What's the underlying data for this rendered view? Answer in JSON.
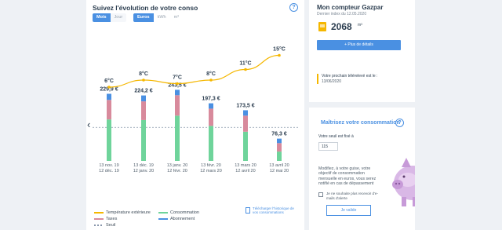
{
  "consumption": {
    "title": "Suivez l'évolution de votre conso",
    "period_options": [
      {
        "label": "Mois",
        "active": true
      },
      {
        "label": "Jour",
        "active": false
      }
    ],
    "unit_options": [
      {
        "label": "Euros",
        "active": true
      },
      {
        "label": "kWh",
        "active": false
      },
      {
        "label": "m³",
        "active": false
      }
    ],
    "legend": {
      "temperature": "Température extérieure",
      "taxes": "Taxes",
      "threshold": "Seuil",
      "consumption": "Consommation",
      "subscription": "Abonnement"
    },
    "download_link": "Télécharger l'historique de vos consommations"
  },
  "chart_data": {
    "type": "bar",
    "categories": [
      [
        "13 nov. 19",
        "12 déc. 19"
      ],
      [
        "13 déc. 19",
        "12 janv. 20"
      ],
      [
        "13 janv. 20",
        "12 févr. 20"
      ],
      [
        "13 févr. 20",
        "12 mars 20"
      ],
      [
        "13 mars 20",
        "12 avril 20"
      ],
      [
        "13 avril 20",
        "12 mai 20"
      ]
    ],
    "totals": [
      "229,9 €",
      "224,2 €",
      "243,5 €",
      "197,3 €",
      "173,5 €",
      "76,3 €"
    ],
    "total_values": [
      229.9,
      224.2,
      243.5,
      197.3,
      173.5,
      76.3
    ],
    "series": [
      {
        "name": "Consommation",
        "color": "#6fd49b",
        "values": [
          142,
          140,
          155,
          120,
          100,
          32
        ]
      },
      {
        "name": "Taxes",
        "color": "#d88a9c",
        "values": [
          67,
          64,
          70,
          59,
          55,
          29
        ]
      },
      {
        "name": "Abonnement",
        "color": "#4a90e2",
        "values": [
          20.9,
          20.2,
          18.5,
          18.3,
          18.5,
          15.3
        ]
      }
    ],
    "threshold": {
      "name": "Seuil",
      "value": 115,
      "color": "#8896ab"
    },
    "temperature": {
      "name": "Température extérieure",
      "color": "#f5b700",
      "values": [
        6,
        8,
        7,
        8,
        11,
        15
      ],
      "labels": [
        "6°C",
        "8°C",
        "7°C",
        "8°C",
        "11°C",
        "15°C"
      ]
    },
    "ylim": [
      0,
      250
    ]
  },
  "meter": {
    "title": "Mon compteur Gazpar",
    "last_reading": "Dernier index du 12.05.2020",
    "value": "2068",
    "unit": "m³",
    "details_button": "+ Plus de détails",
    "next_reading_label": "Votre prochain télérelevé est le :",
    "next_reading_date": "13/06/2020"
  },
  "budget": {
    "title": "Maîtrisez votre consommation",
    "threshold_label": "Votre seuil est fixé à",
    "threshold_value": "115",
    "description": "Modifiez, à votre guise, votre objectif de consommation mensuelle en euros, vous serez notifié en cas de dépassement",
    "alert_label": "Je ne souhaite plus recevoir d'e-mails d'alerte",
    "validate_button": "Je valide"
  }
}
